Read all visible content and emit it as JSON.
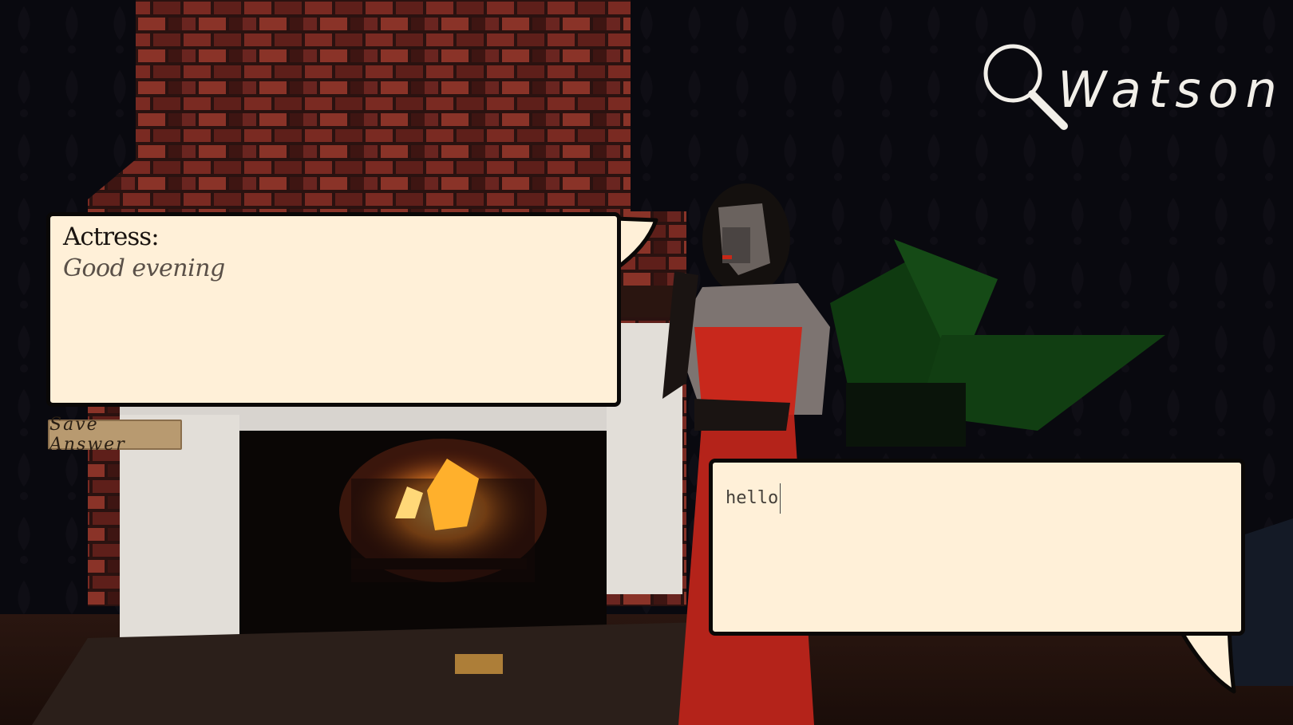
{
  "app": {
    "title": "Watson",
    "logo_icon": "magnifying-glass-icon"
  },
  "dialogue": {
    "npc": {
      "speaker": "Actress:",
      "line": "Good evening"
    },
    "player": {
      "input_value": "hello"
    },
    "save_button_label": "Save Answer"
  },
  "colors": {
    "bubble_fill": "#fff0d8",
    "bubble_border": "#0a0807",
    "button_fill": "#b89a70",
    "dress_red": "#c8281c"
  }
}
